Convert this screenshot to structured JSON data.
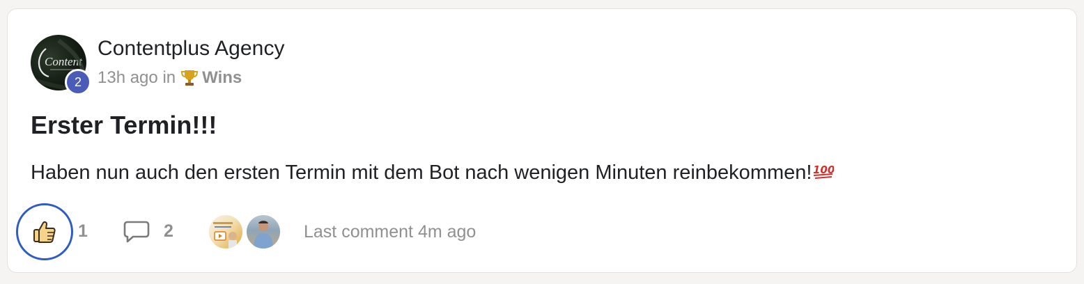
{
  "post": {
    "author_name": "Contentplus Agency",
    "avatar_icon": "contentplus-logo",
    "avatar_logo_text": "Content",
    "level": "2",
    "time_ago": "13h ago",
    "in_word": "in",
    "category_icon": "trophy-icon",
    "category": "Wins",
    "title": "Erster Termin!!!",
    "body": "Haben nun auch den ersten Termin mit dem Bot nach wenigen Minuten reinbekommen!",
    "body_emoji": "hundred-points-emoji",
    "body_emoji_text": "100"
  },
  "actions": {
    "like_icon": "thumbs-up-icon",
    "like_count": "1",
    "comment_icon": "comment-bubble-icon",
    "comment_count": "2",
    "last_comment": "Last comment 4m ago"
  },
  "colors": {
    "level_badge": "#4a5cb8",
    "like_ring": "#2f5bc5",
    "muted_text": "#909090",
    "primary_text": "#202124",
    "emoji_red": "#d0312d"
  }
}
